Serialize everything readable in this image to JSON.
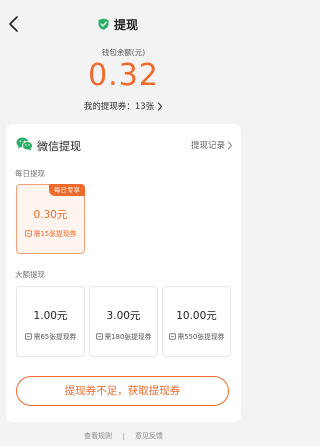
{
  "nav": {
    "title": "提现"
  },
  "wallet": {
    "balance_label": "钱包余额(元)",
    "balance_value": "0.32",
    "voucher_text": "我的提现券：13张"
  },
  "card": {
    "title": "微信提现",
    "record_link": "提现记录",
    "daily_label": "每日提现",
    "daily_badge": "每日专享",
    "daily_tile": {
      "amount": "0.30元",
      "need": "需15张提现券"
    },
    "large_label": "大额提现",
    "large_tiles": [
      {
        "amount": "1.00元",
        "need": "需65张提现券"
      },
      {
        "amount": "3.00元",
        "need": "需180张提现券"
      },
      {
        "amount": "10.00元",
        "need": "需550张提现券"
      }
    ],
    "cta_label": "提现券不足，获取提现券"
  },
  "footer": {
    "rules": "查看规则",
    "feedback": "意见反馈"
  },
  "colors": {
    "accent": "#ef6a2b",
    "wechat_green": "#2aae67",
    "background": "#f3f3f3"
  }
}
